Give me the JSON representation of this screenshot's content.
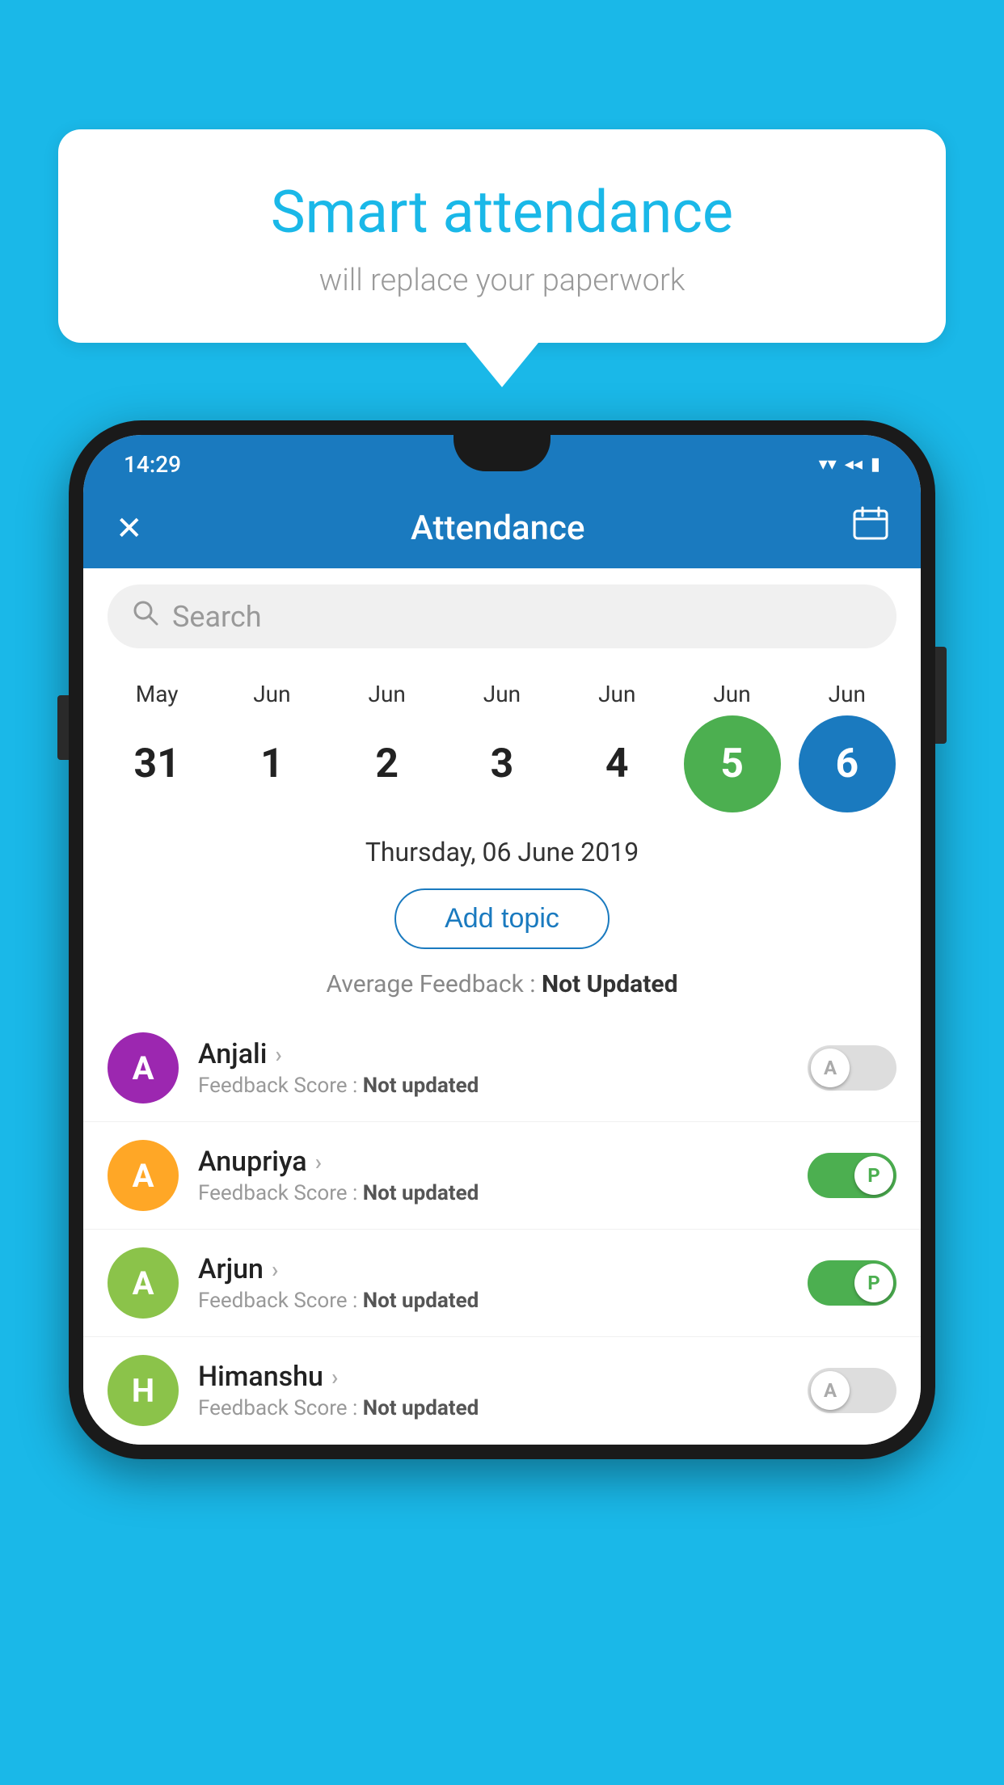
{
  "background_color": "#1ab8e8",
  "speech_bubble": {
    "title": "Smart attendance",
    "subtitle": "will replace your paperwork"
  },
  "status_bar": {
    "time": "14:29",
    "wifi_icon": "▼",
    "signal_icon": "◀",
    "battery_icon": "▮"
  },
  "app_header": {
    "close_label": "✕",
    "title": "Attendance",
    "calendar_icon": "📅"
  },
  "search": {
    "placeholder": "Search"
  },
  "calendar": {
    "months": [
      "May",
      "Jun",
      "Jun",
      "Jun",
      "Jun",
      "Jun",
      "Jun"
    ],
    "dates": [
      "31",
      "1",
      "2",
      "3",
      "4",
      "5",
      "6"
    ],
    "selected_green_index": 5,
    "selected_blue_index": 6
  },
  "selected_date": "Thursday, 06 June 2019",
  "add_topic_label": "Add topic",
  "average_feedback": {
    "label": "Average Feedback : ",
    "value": "Not Updated"
  },
  "students": [
    {
      "name": "Anjali",
      "avatar_letter": "A",
      "avatar_color": "#9c27b0",
      "feedback_label": "Feedback Score : ",
      "feedback_value": "Not updated",
      "toggle_state": "off",
      "toggle_label": "A"
    },
    {
      "name": "Anupriya",
      "avatar_letter": "A",
      "avatar_color": "#ffa726",
      "feedback_label": "Feedback Score : ",
      "feedback_value": "Not updated",
      "toggle_state": "on",
      "toggle_label": "P"
    },
    {
      "name": "Arjun",
      "avatar_letter": "A",
      "avatar_color": "#8bc34a",
      "feedback_label": "Feedback Score : ",
      "feedback_value": "Not updated",
      "toggle_state": "on",
      "toggle_label": "P"
    },
    {
      "name": "Himanshu",
      "avatar_letter": "H",
      "avatar_color": "#8bc34a",
      "feedback_label": "Feedback Score : ",
      "feedback_value": "Not updated",
      "toggle_state": "off",
      "toggle_label": "A"
    }
  ]
}
